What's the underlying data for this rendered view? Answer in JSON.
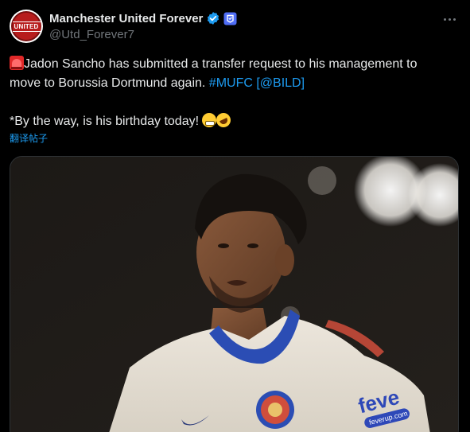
{
  "author": {
    "display_name": "Manchester United Forever",
    "handle": "@Utd_Forever7",
    "avatar_text": "UNITED",
    "verified_color": "#1d9bf0",
    "affiliate_color": "#4f6df5"
  },
  "tweet": {
    "line1_text": "Jadon Sancho has submitted a transfer request to his management to",
    "line2_text": "move to Borussia Dortmund again. ",
    "hashtag": "#MUFC",
    "bracket_open": " [",
    "mention": "@BILD",
    "bracket_close": "]",
    "line4_text": "*By the way, is his birthday today! ",
    "emojis": [
      "siren-emoji",
      "grimacing-emoji",
      "rofl-emoji"
    ]
  },
  "translate_link": "翻译帖子",
  "media": {
    "shirt_sponsor": "feve",
    "sleeve_text": "feverup.com"
  },
  "colors": {
    "background": "#000000",
    "text": "#e7e9ea",
    "secondary": "#71767b",
    "link": "#1d9bf0"
  }
}
